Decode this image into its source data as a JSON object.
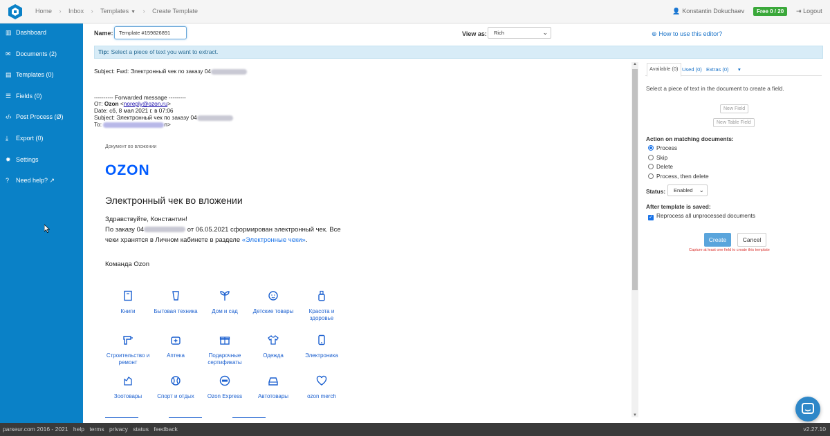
{
  "header": {
    "breadcrumbs": [
      "Home",
      "Inbox",
      "Templates",
      "Create Template"
    ],
    "user_name": "Konstantin Dokuchaev",
    "plan_badge": "Free 0 / 20",
    "logout": "Logout"
  },
  "sidebar": {
    "items": [
      {
        "label": "Dashboard",
        "icon": "bar-chart-icon"
      },
      {
        "label": "Documents (2)",
        "icon": "envelope-icon"
      },
      {
        "label": "Templates (0)",
        "icon": "document-icon"
      },
      {
        "label": "Fields (0)",
        "icon": "sliders-icon"
      },
      {
        "label": "Post Process (Ø)",
        "icon": "code-icon"
      },
      {
        "label": "Export (0)",
        "icon": "download-icon"
      },
      {
        "label": "Settings",
        "icon": "gear-icon"
      },
      {
        "label": "Need help?",
        "icon": "question-icon"
      }
    ]
  },
  "toolbar": {
    "name_label": "Name:",
    "name_value": "Template #159826891",
    "viewas_label": "View as:",
    "viewas_value": "Rich",
    "howto": "How to use this editor?"
  },
  "tip": {
    "label": "Tip:",
    "text": "Select a piece of text you want to extract."
  },
  "email": {
    "subject_top": "Subject: Fwd: Электронный чек по заказу 04",
    "forwarded": "---------- Forwarded message ---------",
    "from_prefix": "От: ",
    "from_name": "Ozon",
    "from_email": "noreply@ozon.ru",
    "date": "Date: сб, 8 мая 2021 г. в 07:06",
    "subject": "Subject: Электронный чек по заказу 04",
    "to_prefix": "To: ",
    "to_suffix": "n>",
    "caption": "Документ во вложении",
    "logo_text": "OZON",
    "title": "Электронный чек во вложении",
    "greeting": "Здравствуйте, Константин!",
    "body_1": "По заказу 04",
    "body_2": " от 06.05.2021 сформирован электронный чек. Все чеки хранятся в Личном кабинете в разделе ",
    "body_link": "«Электронные чеки»",
    "body_end": ".",
    "team": "Команда Ozon",
    "categories": [
      {
        "label": "Книги",
        "icon": "book-icon"
      },
      {
        "label": "Бытовая техника",
        "icon": "appliance-icon"
      },
      {
        "label": "Дом и сад",
        "icon": "plant-icon"
      },
      {
        "label": "Детские товары",
        "icon": "baby-icon"
      },
      {
        "label": "Красота и здоровье",
        "icon": "bottle-icon"
      },
      {
        "label": "Строительство и ремонт",
        "icon": "drill-icon"
      },
      {
        "label": "Аптека",
        "icon": "medkit-icon"
      },
      {
        "label": "Подарочные сертификаты",
        "icon": "gift-icon"
      },
      {
        "label": "Одежда",
        "icon": "shirt-icon"
      },
      {
        "label": "Электроника",
        "icon": "phone-icon"
      },
      {
        "label": "Зоотовары",
        "icon": "pet-icon"
      },
      {
        "label": "Спорт и отдых",
        "icon": "ball-icon"
      },
      {
        "label": "Ozon Express",
        "icon": "express-icon"
      },
      {
        "label": "Автотовары",
        "icon": "car-icon"
      },
      {
        "label": "ozon merch",
        "icon": "heart-icon"
      }
    ]
  },
  "panel": {
    "tabs": [
      "Available (0)",
      "Used (0)",
      "Extras (0)"
    ],
    "hint": "Select a piece of text in the document to create a field.",
    "new_field": "New Field",
    "new_table_field": "New Table Field",
    "action_label": "Action on matching documents:",
    "actions": [
      "Process",
      "Skip",
      "Delete",
      "Process, then delete"
    ],
    "selected_action": "Process",
    "status_label": "Status:",
    "status_value": "Enabled",
    "after_saved_label": "After template is saved:",
    "reprocess_label": "Reprocess all unprocessed documents",
    "create": "Create",
    "cancel": "Cancel",
    "error": "Capture at least one field to create this template"
  },
  "footer": {
    "links": [
      "parseur.com  2016 - 2021",
      "help",
      "terms",
      "privacy",
      "status",
      "feedback"
    ],
    "version": "v2.27.10"
  },
  "colors": {
    "sidebar": "#0a81c7",
    "accent": "#1a73e8",
    "ozon_blue": "#005bff",
    "badge_green": "#3aa83a",
    "error_red": "#d9302c"
  }
}
